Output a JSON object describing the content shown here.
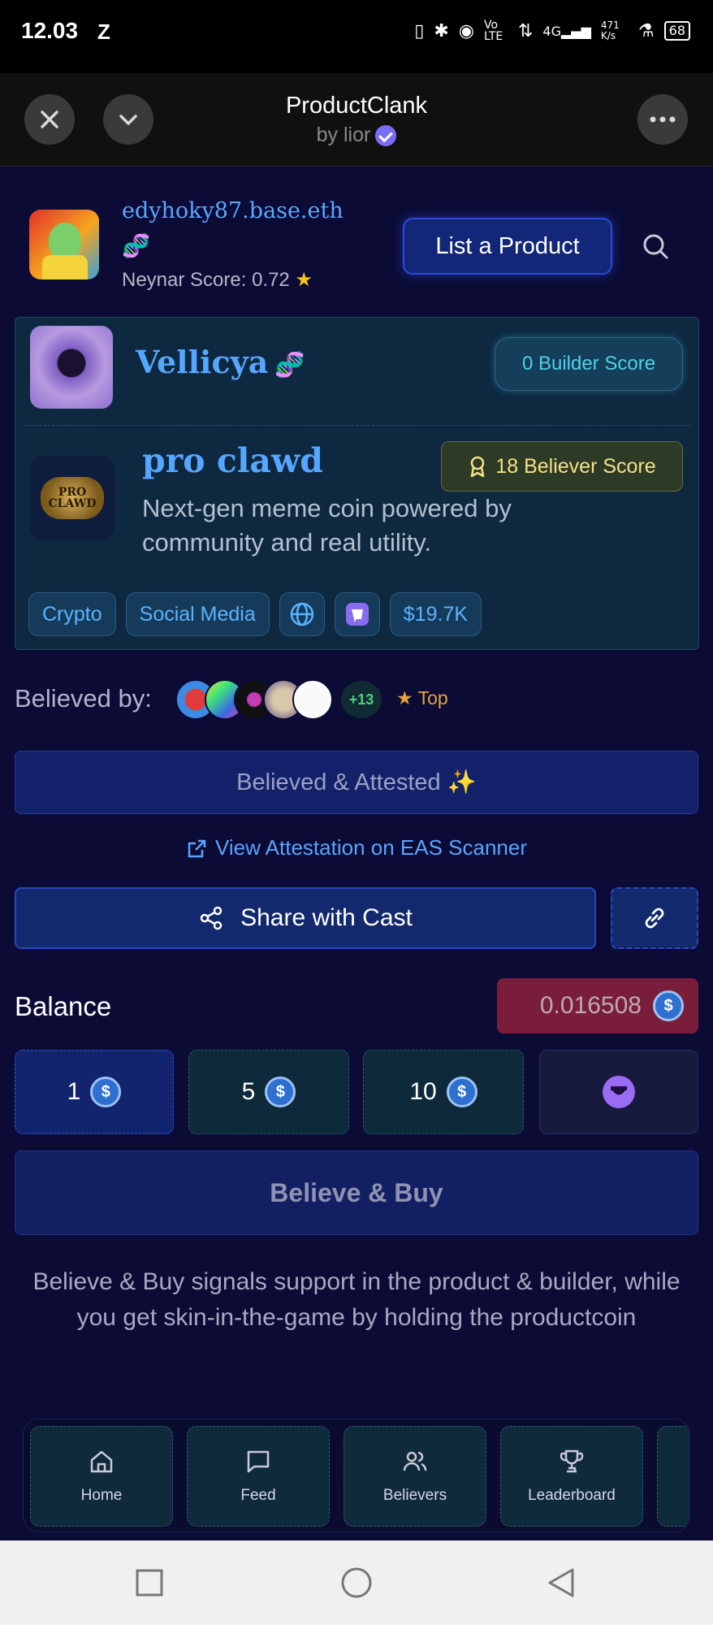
{
  "status_bar": {
    "time": "12.03",
    "z_icon": "Z",
    "network_rate": "471 K/s",
    "lte": "Vo LTE",
    "signal": "4G",
    "battery": "68"
  },
  "topbar": {
    "title": "ProductClank",
    "subtitle": "by lior"
  },
  "user": {
    "name": "edyhoky87.base.eth",
    "neynar_label": "Neynar Score: 0.72",
    "dna_icon": "dna-emoji"
  },
  "header": {
    "list_product_label": "List a Product"
  },
  "builder": {
    "name": "Vellicya",
    "builder_score": "0 Builder Score"
  },
  "product": {
    "name": "pro clawd",
    "description": "Next-gen meme coin powered by community and real utility.",
    "believer_score": "18 Believer Score",
    "logo_text": "PRO CLAWD"
  },
  "tags": {
    "crypto": "Crypto",
    "social": "Social Media",
    "market_cap": "$19.7K"
  },
  "believed": {
    "label": "Believed by:",
    "more": "+13",
    "top": "★ Top"
  },
  "actions": {
    "attested": "Believed & Attested ✨",
    "view_attestation": "View Attestation on EAS Scanner",
    "share": "Share with Cast"
  },
  "balance": {
    "label": "Balance",
    "value": "0.016508"
  },
  "amounts": [
    "1",
    "5",
    "10"
  ],
  "buy": {
    "label": "Believe & Buy",
    "description": "Believe & Buy signals support in the product & builder, while you get skin-in-the-game by holding the productcoin"
  },
  "nav": {
    "home": "Home",
    "feed": "Feed",
    "believers": "Believers",
    "leaderboard": "Leaderboard"
  },
  "colors": {
    "background": "#0b0b35",
    "accent": "#55a6ff",
    "balance_bg": "#7a1d3a",
    "believer_gold": "#f6e186",
    "builder_cyan": "#4fd1e7"
  }
}
